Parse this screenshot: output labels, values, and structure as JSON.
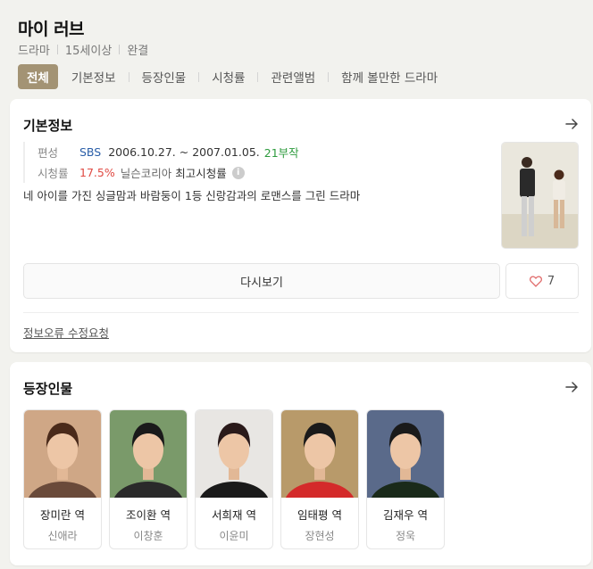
{
  "header": {
    "title": "마이 러브",
    "meta": [
      "드라마",
      "15세이상",
      "완결"
    ]
  },
  "tabs": [
    {
      "label": "전체",
      "active": true
    },
    {
      "label": "기본정보",
      "active": false
    },
    {
      "label": "등장인물",
      "active": false
    },
    {
      "label": "시청률",
      "active": false
    },
    {
      "label": "관련앨범",
      "active": false
    },
    {
      "label": "함께 볼만한 드라마",
      "active": false
    }
  ],
  "basic_info": {
    "title": "기본정보",
    "schedule_label": "편성",
    "broadcaster": "SBS",
    "period": "2006.10.27. ~ 2007.01.05.",
    "episodes": "21부작",
    "rating_label": "시청률",
    "rating_value": "17.5%",
    "rating_source": "닐슨코리아",
    "rating_note": "최고시청률",
    "info_icon": "i",
    "description": "네 아이를 가진 싱글맘과 바람둥이 1등 신랑감과의 로맨스를 그린 드라마",
    "rewatch_label": "다시보기",
    "like_count": "7",
    "report_label": "정보오류 수정요청"
  },
  "cast_section": {
    "title": "등장인물",
    "items": [
      {
        "role": "장미란 역",
        "actor": "신애라",
        "bg": "#cfa786",
        "shirt": "#6a4a3a",
        "hair": "#4a2a1a"
      },
      {
        "role": "조이환 역",
        "actor": "이창훈",
        "bg": "#7a9a6a",
        "shirt": "#2a2a2a",
        "hair": "#1a1a1a"
      },
      {
        "role": "서희재 역",
        "actor": "이윤미",
        "bg": "#e8e6e3",
        "shirt": "#1a1a1a",
        "hair": "#2a1a1a"
      },
      {
        "role": "임태평 역",
        "actor": "장현성",
        "bg": "#b89a6a",
        "shirt": "#d42a2a",
        "hair": "#1a1a1a"
      },
      {
        "role": "김재우 역",
        "actor": "정욱",
        "bg": "#5a6a8a",
        "shirt": "#1a2a1a",
        "hair": "#1a1a1a"
      }
    ]
  },
  "colors": {
    "accent": "#a39374",
    "broadcaster_blue": "#2a5ea8",
    "episodes_green": "#2e9b3e",
    "rating_red": "#e04a43",
    "heart": "#e06a6a"
  },
  "icons": {
    "arrow": "arrow-right-icon",
    "heart": "heart-icon",
    "info": "info-icon"
  }
}
